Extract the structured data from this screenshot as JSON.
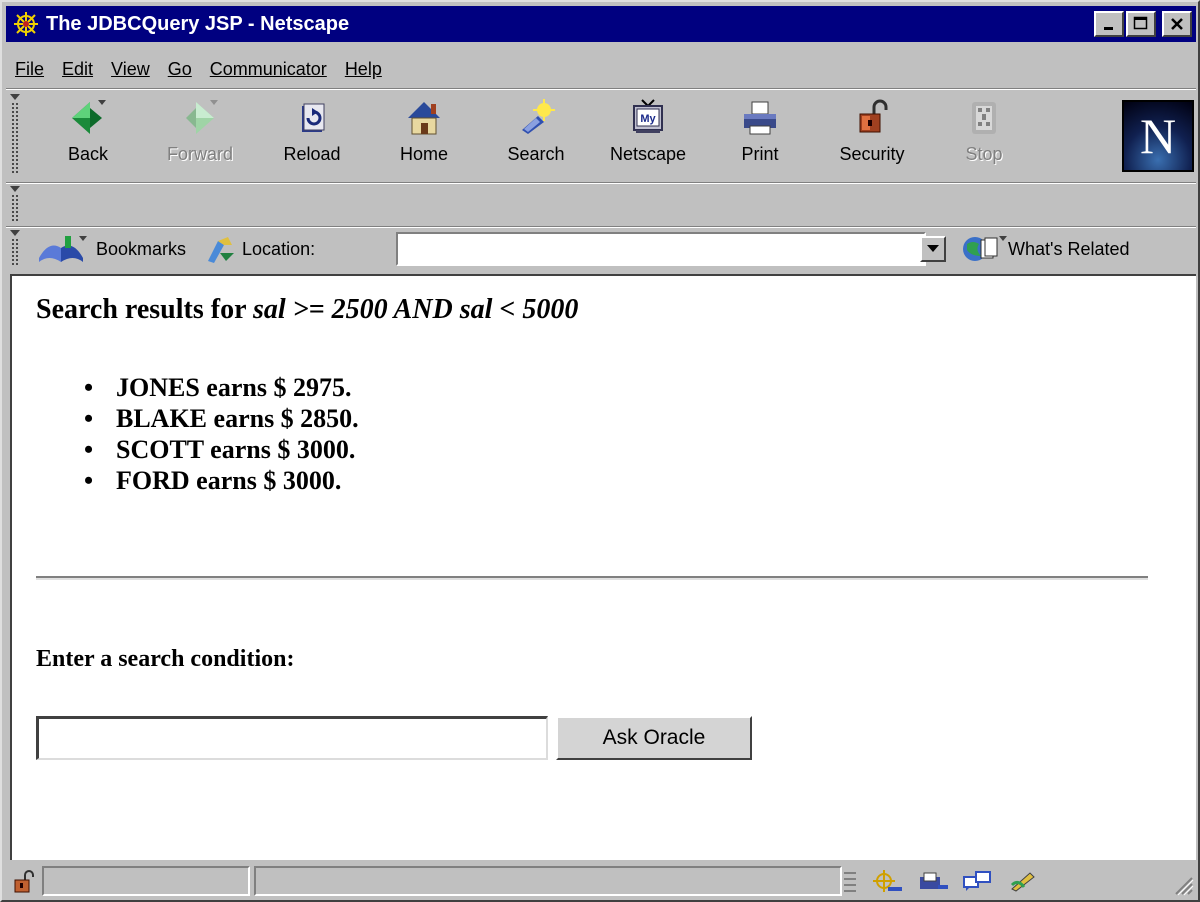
{
  "window": {
    "title": "The JDBCQuery JSP - Netscape",
    "title_bar_color": "#000080"
  },
  "menu": [
    "File",
    "Edit",
    "View",
    "Go",
    "Communicator",
    "Help"
  ],
  "toolbar": {
    "buttons": [
      {
        "label": "Back",
        "icon": "back-arrow-icon",
        "enabled": true
      },
      {
        "label": "Forward",
        "icon": "forward-arrow-icon",
        "enabled": false
      },
      {
        "label": "Reload",
        "icon": "reload-icon",
        "enabled": true
      },
      {
        "label": "Home",
        "icon": "home-icon",
        "enabled": true
      },
      {
        "label": "Search",
        "icon": "search-icon",
        "enabled": true
      },
      {
        "label": "Netscape",
        "icon": "my-netscape-icon",
        "enabled": true
      },
      {
        "label": "Print",
        "icon": "printer-icon",
        "enabled": true
      },
      {
        "label": "Security",
        "icon": "padlock-icon",
        "enabled": true
      },
      {
        "label": "Stop",
        "icon": "stop-icon",
        "enabled": false
      }
    ]
  },
  "location_bar": {
    "bookmarks_label": "Bookmarks",
    "location_label": "Location:",
    "url": "",
    "related_label": "What's Related"
  },
  "page": {
    "heading_prefix": "Search results for",
    "heading_condition_parts": [
      "sal",
      ">= 2500 AND",
      "sal",
      "< 5000"
    ],
    "results": [
      "JONES earns $ 2975.",
      "BLAKE earns $ 2850.",
      "SCOTT earns $ 3000.",
      "FORD earns $ 3000."
    ],
    "prompt": "Enter a search condition:",
    "input_value": "",
    "submit_label": "Ask Oracle"
  }
}
